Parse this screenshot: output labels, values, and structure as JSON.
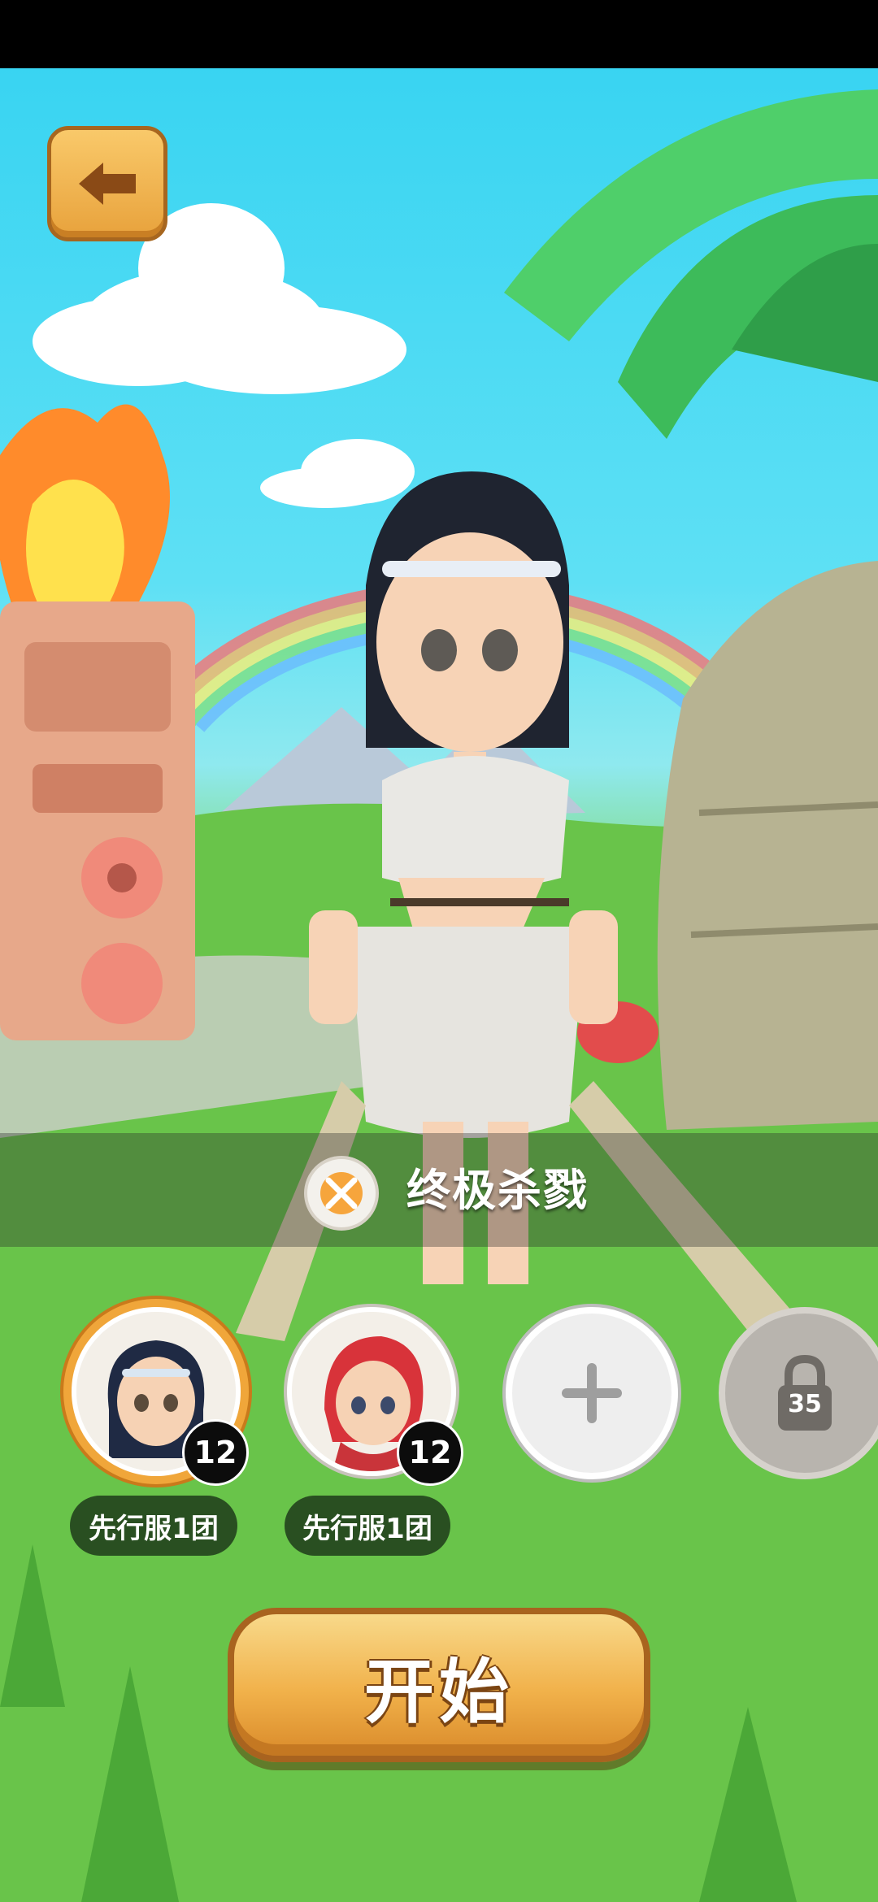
{
  "skill": {
    "name": "终极杀戮",
    "icon": "crossed-blades-icon"
  },
  "team": [
    {
      "level": "12",
      "server_tag": "先行服1团",
      "selected": true
    },
    {
      "level": "12",
      "server_tag": "先行服1团",
      "selected": false
    }
  ],
  "add_slot": {
    "icon": "plus-icon"
  },
  "locked_slot": {
    "unlock_level": "35",
    "icon": "lock-icon"
  },
  "start_button": {
    "label": "开始"
  },
  "back_button": {
    "icon": "back-arrow-icon"
  }
}
